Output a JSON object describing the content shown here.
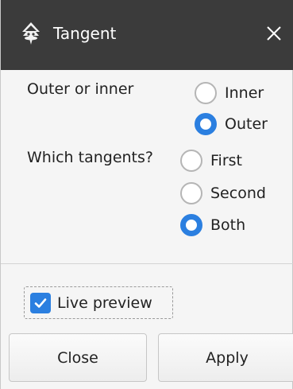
{
  "window": {
    "title": "Tangent",
    "app_icon": "inkscape-icon",
    "close_icon": "close-icon"
  },
  "options": {
    "outer_or_inner": {
      "label": "Outer or inner",
      "choices": [
        {
          "label": "Inner",
          "selected": false
        },
        {
          "label": "Outer",
          "selected": true
        }
      ]
    },
    "which_tangents": {
      "label": "Which tangents?",
      "choices": [
        {
          "label": "First",
          "selected": false
        },
        {
          "label": "Second",
          "selected": false
        },
        {
          "label": "Both",
          "selected": true
        }
      ]
    }
  },
  "live_preview": {
    "label": "Live preview",
    "checked": true
  },
  "buttons": {
    "close": "Close",
    "apply": "Apply"
  },
  "colors": {
    "accent": "#2b7fe0",
    "titlebar": "#3b3b3b"
  }
}
